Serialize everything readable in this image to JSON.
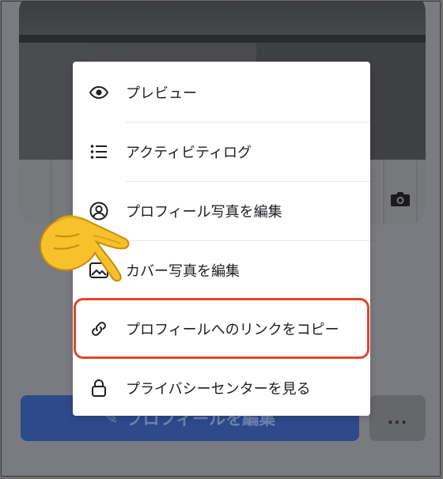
{
  "menu": {
    "items": [
      {
        "label": "プレビュー",
        "icon": "eye-icon"
      },
      {
        "label": "アクティビティログ",
        "icon": "list-icon"
      },
      {
        "label": "プロフィール写真を編集",
        "icon": "profile-icon"
      },
      {
        "label": "カバー写真を編集",
        "icon": "image-icon"
      },
      {
        "label": "プロフィールへのリンクをコピー",
        "icon": "link-icon"
      },
      {
        "label": "プライバシーセンターを見る",
        "icon": "lock-icon"
      }
    ]
  },
  "background": {
    "edit_profile_label": "プロフィールを編集",
    "more_label": "..."
  },
  "colors": {
    "highlight": "#e0472a",
    "edit_button": "#2d4a8a",
    "overlay": "#6f6f72"
  }
}
